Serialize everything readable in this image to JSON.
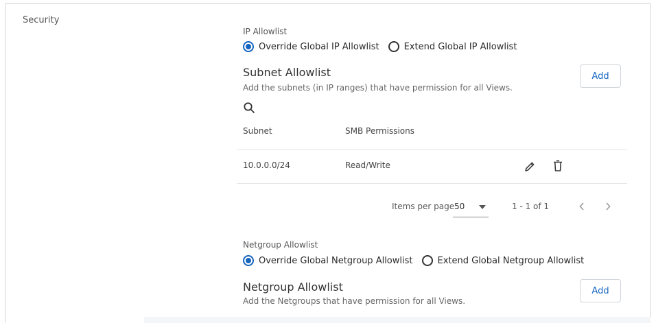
{
  "section": {
    "title": "Security"
  },
  "ip_allowlist": {
    "label": "IP Allowlist",
    "options": [
      "Override Global IP Allowlist",
      "Extend Global IP Allowlist"
    ],
    "selected": 0
  },
  "subnet_allowlist": {
    "heading": "Subnet Allowlist",
    "description": "Add the subnets (in IP ranges) that have permission for all Views.",
    "add_label": "Add",
    "columns": [
      "Subnet",
      "SMB Permissions"
    ],
    "rows": [
      {
        "subnet": "10.0.0.0/24",
        "permissions": "Read/Write"
      }
    ],
    "pagination": {
      "items_per_page_label": "Items per page",
      "items_per_page": "50",
      "range": "1 - 1 of 1"
    }
  },
  "netgroup_allowlist": {
    "label": "Netgroup Allowlist",
    "options": [
      "Override Global Netgroup Allowlist",
      "Extend Global Netgroup Allowlist"
    ],
    "selected": 0,
    "heading": "Netgroup Allowlist",
    "description": "Add the Netgroups that have permission for all Views.",
    "add_label": "Add"
  },
  "colors": {
    "accent": "#1565c0",
    "divider": "#e3e5e8"
  }
}
